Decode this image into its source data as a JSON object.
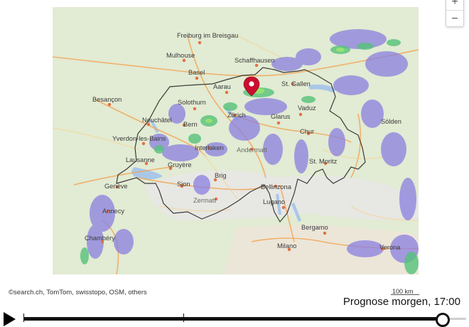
{
  "map": {
    "cities": [
      {
        "name": "Freiburg im Breisgau"
      },
      {
        "name": "Mulhouse"
      },
      {
        "name": "Basel"
      },
      {
        "name": "Schaffhausen"
      },
      {
        "name": "Aarau"
      },
      {
        "name": "St. Gallen"
      },
      {
        "name": "Besançon"
      },
      {
        "name": "Solothurn"
      },
      {
        "name": "Zürich"
      },
      {
        "name": "Vaduz"
      },
      {
        "name": "Neuchâtel"
      },
      {
        "name": "Bern"
      },
      {
        "name": "Glarus"
      },
      {
        "name": "Chur"
      },
      {
        "name": "Sölden"
      },
      {
        "name": "Yverdon-les-Bains"
      },
      {
        "name": "Lausanne"
      },
      {
        "name": "Interlaken"
      },
      {
        "name": "Andermatt"
      },
      {
        "name": "St. Moritz"
      },
      {
        "name": "Genève"
      },
      {
        "name": "Gruyère"
      },
      {
        "name": "Brig"
      },
      {
        "name": "Sion"
      },
      {
        "name": "Bellinzona"
      },
      {
        "name": "Zermatt"
      },
      {
        "name": "Lugano"
      },
      {
        "name": "Annecy"
      },
      {
        "name": "Chambéry"
      },
      {
        "name": "Bergamo"
      },
      {
        "name": "Milano"
      },
      {
        "name": "Verona"
      }
    ],
    "marker_color": "#cc0e2e",
    "border_color": "#3a3a3a",
    "rain_colors": [
      "#7b6fd6",
      "#9a8fe6",
      "#56c27a",
      "#8fe06a"
    ]
  },
  "zoom": {
    "in_label": "+",
    "out_label": "−"
  },
  "attribution": "©search.ch, TomTom, swisstopo, OSM, others",
  "scale_label": "100 km",
  "forecast_label": "Prognose morgen, 17:00"
}
